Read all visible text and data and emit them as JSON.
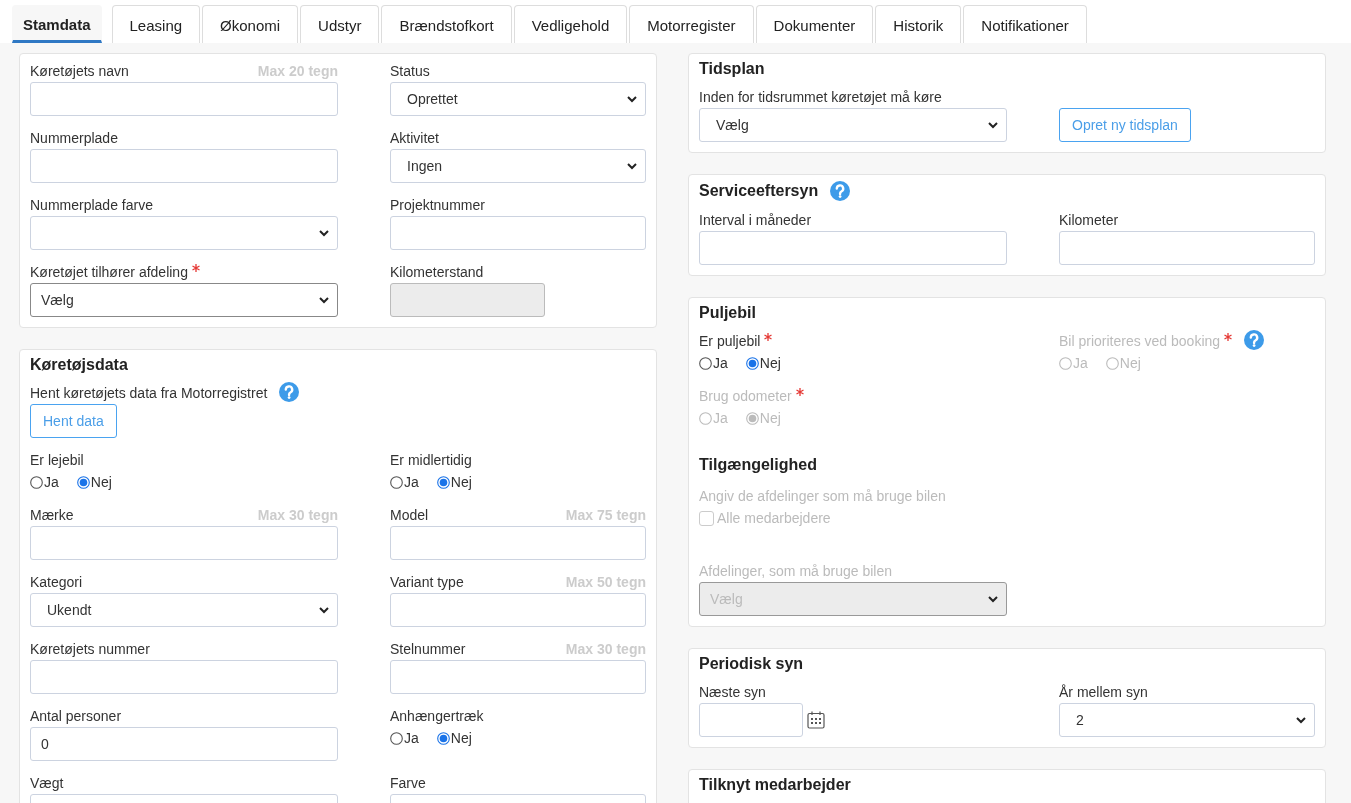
{
  "tabs": [
    {
      "label": "Stamdata",
      "selected": true
    },
    {
      "label": "Leasing",
      "selected": false
    },
    {
      "label": "Økonomi",
      "selected": false
    },
    {
      "label": "Udstyr",
      "selected": false
    },
    {
      "label": "Brændstofkort",
      "selected": false
    },
    {
      "label": "Vedligehold",
      "selected": false
    },
    {
      "label": "Motorregister",
      "selected": false
    },
    {
      "label": "Dokumenter",
      "selected": false
    },
    {
      "label": "Historik",
      "selected": false
    },
    {
      "label": "Notifikationer",
      "selected": false
    }
  ],
  "left_panels": [
    {
      "fields": [
        {
          "kind": "text",
          "label": "Køretøjets navn",
          "hint": "Max 20 tegn"
        },
        {
          "kind": "select",
          "label": "Status",
          "value": "Oprettet"
        },
        {
          "kind": "text",
          "label": "Nummerplade"
        },
        {
          "kind": "select",
          "label": "Aktivitet",
          "value": "Ingen"
        },
        {
          "kind": "select",
          "label": "Nummerplade farve"
        },
        {
          "kind": "text",
          "label": "Projektnummer"
        },
        {
          "kind": "select",
          "label": "Køretøjet tilhører afdeling",
          "required": true,
          "value": "Vælg",
          "strong": true
        },
        {
          "kind": "text",
          "label": "Kilometerstand",
          "disabled": true,
          "short": true
        }
      ]
    },
    {
      "title": "Køretøjsdata",
      "fields": [
        {
          "kind": "action",
          "label": "Hent køretøjets data fra Motorregistret",
          "help": true,
          "button": "Hent data"
        },
        {
          "kind": "radio",
          "label": "Er lejebil",
          "options": [
            {
              "label": "Ja",
              "selected": false
            },
            {
              "label": "Nej",
              "selected": true
            }
          ]
        },
        {
          "kind": "radio",
          "label": "Er midlertidig",
          "options": [
            {
              "label": "Ja",
              "selected": false
            },
            {
              "label": "Nej",
              "selected": true
            }
          ]
        },
        {
          "kind": "text",
          "label": "Mærke",
          "hint": "Max 30 tegn"
        },
        {
          "kind": "text",
          "label": "Model",
          "hint": "Max 75 tegn"
        },
        {
          "kind": "select",
          "label": "Kategori",
          "value": "Ukendt"
        },
        {
          "kind": "text",
          "label": "Variant type",
          "hint": "Max 50 tegn"
        },
        {
          "kind": "text",
          "label": "Køretøjets nummer"
        },
        {
          "kind": "text",
          "label": "Stelnummer",
          "hint": "Max 30 tegn"
        },
        {
          "kind": "text",
          "label": "Antal personer",
          "value": "0"
        },
        {
          "kind": "radio",
          "label": "Anhængertræk",
          "options": [
            {
              "label": "Ja",
              "selected": false
            },
            {
              "label": "Nej",
              "selected": true
            }
          ]
        },
        {
          "kind": "text",
          "label": "Vægt"
        },
        {
          "kind": "text",
          "label": "Farve"
        }
      ]
    }
  ],
  "right_panels": [
    {
      "title": "Tidsplan",
      "fields": [
        {
          "kind": "select",
          "label": "Inden for tidsrummet køretøjet må køre",
          "value": "Vælg"
        },
        {
          "kind": "button",
          "label": "Opret ny tidsplan"
        }
      ]
    },
    {
      "title": "Serviceeftersyn",
      "help": true,
      "fields": [
        {
          "kind": "text",
          "label": "Interval i måneder"
        },
        {
          "kind": "text",
          "label": "Kilometer"
        }
      ]
    },
    {
      "title": "Puljebil",
      "fields": [
        {
          "kind": "radio",
          "label": "Er puljebil",
          "required": true,
          "options": [
            {
              "label": "Ja",
              "selected": false
            },
            {
              "label": "Nej",
              "selected": true
            }
          ]
        },
        {
          "kind": "radio",
          "label": "Bil prioriteres ved booking",
          "required": true,
          "help": true,
          "disabled": true,
          "options": [
            {
              "label": "Ja",
              "selected": false
            },
            {
              "label": "Nej",
              "selected": false
            }
          ]
        },
        {
          "kind": "radio",
          "label": "Brug odometer",
          "required": true,
          "disabled": true,
          "options": [
            {
              "label": "Ja",
              "selected": false
            },
            {
              "label": "Nej",
              "selected": true
            }
          ]
        },
        {
          "kind": "heading",
          "label": "Tilgængelighed"
        },
        {
          "kind": "checkbox",
          "label": "Angiv de afdelinger som må bruge bilen",
          "option": "Alle medarbejdere",
          "checked": false,
          "disabled": true
        },
        {
          "kind": "select",
          "label": "Afdelinger, som må bruge bilen",
          "value": "Vælg",
          "disabled": true
        }
      ]
    },
    {
      "title": "Periodisk syn",
      "fields": [
        {
          "kind": "date",
          "label": "Næste syn"
        },
        {
          "kind": "select",
          "label": "År mellem syn",
          "value": "2"
        }
      ]
    },
    {
      "title": "Tilknyt medarbejder"
    }
  ]
}
